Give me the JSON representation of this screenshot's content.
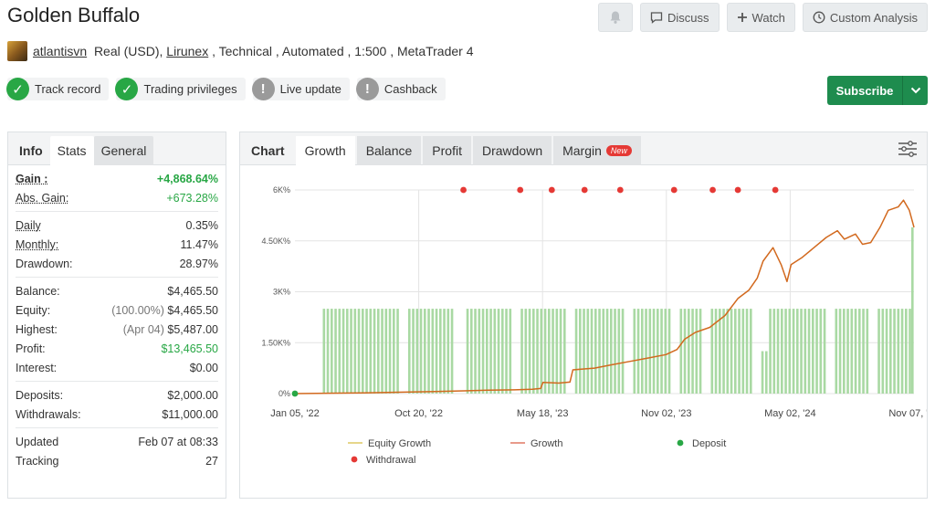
{
  "header": {
    "title": "Golden Buffalo",
    "actions": {
      "discuss": "Discuss",
      "watch": "Watch",
      "custom": "Custom Analysis"
    }
  },
  "meta": {
    "user": "atlantisvn",
    "account_type": "Real (USD),",
    "broker": "Lirunex",
    "rest": " , Technical , Automated , 1:500 , MetaTrader 4"
  },
  "badges": [
    {
      "label": "Track record",
      "status": "ok"
    },
    {
      "label": "Trading privileges",
      "status": "ok"
    },
    {
      "label": "Live update",
      "status": "warn"
    },
    {
      "label": "Cashback",
      "status": "warn"
    }
  ],
  "subscribe_label": "Subscribe",
  "left_tabs": [
    "Info",
    "Stats",
    "General"
  ],
  "stats": {
    "gain": {
      "label": "Gain :",
      "value": "+4,868.64%"
    },
    "abs_gain": {
      "label": "Abs. Gain:",
      "value": "+673.28%"
    },
    "daily": {
      "label": "Daily",
      "value": "0.35%"
    },
    "monthly": {
      "label": "Monthly:",
      "value": "11.47%"
    },
    "drawdown": {
      "label": "Drawdown:",
      "value": "28.97%"
    },
    "balance": {
      "label": "Balance:",
      "value": "$4,465.50"
    },
    "equity": {
      "label": "Equity:",
      "prefix": "(100.00%)",
      "value": "$4,465.50"
    },
    "highest": {
      "label": "Highest:",
      "prefix": "(Apr 04)",
      "value": "$5,487.00"
    },
    "profit": {
      "label": "Profit:",
      "value": "$13,465.50"
    },
    "interest": {
      "label": "Interest:",
      "value": "$0.00"
    },
    "deposits": {
      "label": "Deposits:",
      "value": "$2,000.00"
    },
    "withdrawals": {
      "label": "Withdrawals:",
      "value": "$11,000.00"
    },
    "updated": {
      "label": "Updated",
      "value": "Feb 07 at 08:33"
    },
    "tracking": {
      "label": "Tracking",
      "value": "27"
    }
  },
  "chart_tabs": [
    "Chart",
    "Growth",
    "Balance",
    "Profit",
    "Drawdown",
    "Margin"
  ],
  "new_badge": "New",
  "colors": {
    "accent_green": "#1e8c4e",
    "growth_line": "#d2691e",
    "equity_bars": "#a9d9a3",
    "withdrawal_dot": "#e53935",
    "deposit_dot": "#28a745"
  },
  "chart_data": {
    "type": "line",
    "title": "",
    "ylabel": "",
    "y_ticks": [
      "0%",
      "1.50K%",
      "3K%",
      "4.50K%",
      "6K%"
    ],
    "ylim": [
      0,
      6000
    ],
    "x_ticks": [
      "Jan 05, '22",
      "Oct 20, '22",
      "May 18, '23",
      "Nov 02, '23",
      "May 02, '24",
      "Nov 07, '24"
    ],
    "x_range": [
      "2022-01-05",
      "2024-11-28"
    ],
    "series": [
      {
        "name": "Growth",
        "x": [
          "2022-01-05",
          "2022-03-01",
          "2022-05-01",
          "2022-07-01",
          "2022-09-01",
          "2022-10-20",
          "2022-12-01",
          "2023-01-15",
          "2023-02-15",
          "2023-03-01",
          "2023-03-05",
          "2023-04-01",
          "2023-04-20",
          "2023-04-25",
          "2023-06-01",
          "2023-07-01",
          "2023-08-01",
          "2023-09-01",
          "2023-10-01",
          "2023-10-20",
          "2023-11-02",
          "2023-11-20",
          "2023-12-15",
          "2024-01-10",
          "2024-02-01",
          "2024-02-20",
          "2024-03-05",
          "2024-03-15",
          "2024-04-01",
          "2024-04-15",
          "2024-04-25",
          "2024-05-02",
          "2024-05-20",
          "2024-06-10",
          "2024-07-01",
          "2024-07-20",
          "2024-08-01",
          "2024-08-20",
          "2024-09-01",
          "2024-09-15",
          "2024-10-01",
          "2024-10-15",
          "2024-11-01",
          "2024-11-10",
          "2024-11-20",
          "2024-11-28"
        ],
        "y": [
          0,
          10,
          20,
          40,
          60,
          80,
          100,
          110,
          130,
          150,
          330,
          310,
          340,
          700,
          750,
          850,
          950,
          1050,
          1150,
          1300,
          1600,
          1800,
          1950,
          2300,
          2800,
          3050,
          3400,
          3900,
          4300,
          3800,
          3300,
          3800,
          4000,
          4300,
          4600,
          4800,
          4550,
          4700,
          4400,
          4450,
          4900,
          5400,
          5500,
          5700,
          5400,
          4900
        ]
      },
      {
        "name": "Equity Growth",
        "x": [
          "2022-01-05",
          "2022-02-15",
          "2022-12-01",
          "2023-03-01",
          "2023-10-01",
          "2024-02-15",
          "2024-03-01",
          "2024-03-25",
          "2024-11-20",
          "2024-11-28"
        ],
        "y": [
          0,
          2500,
          2500,
          2500,
          2500,
          2500,
          1250,
          2500,
          2500,
          4900
        ]
      }
    ],
    "withdrawals_x": [
      "2022-10-20",
      "2023-01-25",
      "2023-03-20",
      "2023-05-15",
      "2023-07-15",
      "2023-10-15",
      "2023-12-20",
      "2024-02-01",
      "2024-04-05"
    ],
    "deposits_x": [
      "2022-01-05"
    ],
    "legend": [
      "Equity Growth",
      "Growth",
      "Deposit",
      "Withdrawal"
    ],
    "grid": true
  }
}
